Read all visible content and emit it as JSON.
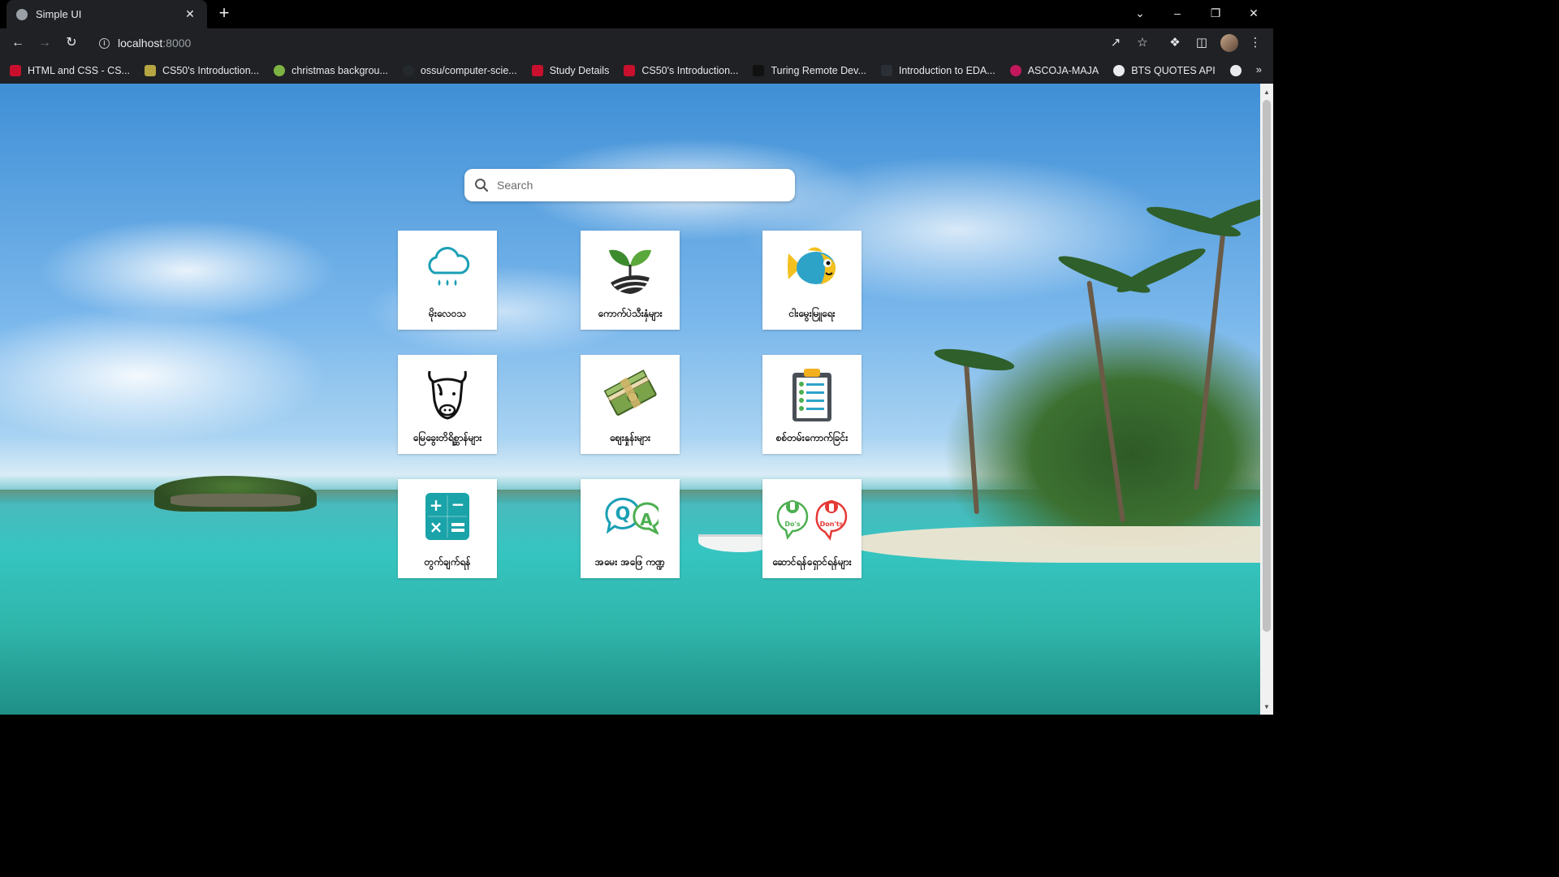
{
  "browser": {
    "tab_title": "Simple UI",
    "tab_close": "✕",
    "new_tab": "+",
    "url_host": "localhost",
    "url_port": ":8000",
    "window_controls": [
      "⌄",
      "–",
      "❐",
      "✕"
    ],
    "bookmarks": [
      {
        "label": "HTML and CSS - CS...",
        "color": "#c8102e"
      },
      {
        "label": "CS50's Introduction...",
        "color": "#b5a642"
      },
      {
        "label": "christmas backgrou...",
        "color": "#7cb342"
      },
      {
        "label": "ossu/computer-scie...",
        "color": "#24292e"
      },
      {
        "label": "Study Details",
        "color": "#c8102e"
      },
      {
        "label": "CS50's Introduction...",
        "color": "#c8102e"
      },
      {
        "label": "Turing Remote Dev...",
        "color": "#111111"
      },
      {
        "label": "Introduction to EDA...",
        "color": "#2b2f36"
      },
      {
        "label": "ASCOJA-MAJA",
        "color": "#c2185b"
      },
      {
        "label": "BTS QUOTES API",
        "color": "#e8eaed"
      }
    ],
    "bookmarks_more": "»"
  },
  "search": {
    "placeholder": "Search"
  },
  "tiles": [
    {
      "label": "မိုးလေဝသ",
      "icon": "rain-cloud-icon"
    },
    {
      "label": "ကောက်ပဲသီးနှံများ",
      "icon": "sprout-icon"
    },
    {
      "label": "ငါးမွေးမြူရေး",
      "icon": "fish-icon"
    },
    {
      "label": "မြေခွေးတိရိစ္ဆာန်များ",
      "icon": "cow-icon"
    },
    {
      "label": "ဈေးနှုန်းများ",
      "icon": "money-icon"
    },
    {
      "label": "စစ်တမ်းကောက်ခြင်း",
      "icon": "clipboard-icon"
    },
    {
      "label": "တွက်ချက်ရန်",
      "icon": "calculator-icon"
    },
    {
      "label": "အမေး အဖြေ ကဏ္ဍ",
      "icon": "qa-icon"
    },
    {
      "label": "ဆောင်ရန်ရှောင်ရန်များ",
      "icon": "dos-donts-icon"
    }
  ],
  "colors": {
    "teal": "#1a9fb5",
    "green": "#3d8b2f",
    "fish_blue": "#2ea3c8",
    "fish_yellow": "#f2c01f",
    "calc": "#1aa3a8"
  }
}
